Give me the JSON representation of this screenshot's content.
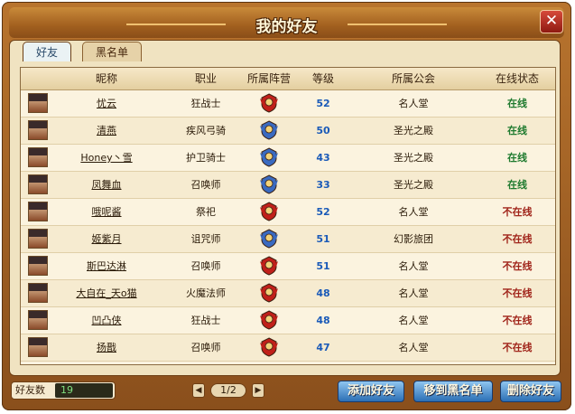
{
  "window": {
    "title": "我的好友",
    "close_label": "✕"
  },
  "tabs": [
    {
      "label": "好友"
    },
    {
      "label": "黑名单"
    }
  ],
  "table": {
    "headers": [
      "昵称",
      "职业",
      "所属阵营",
      "等级",
      "所属公会",
      "在线状态"
    ],
    "rows": [
      {
        "name": "忧云",
        "job": "狂战士",
        "faction": "red",
        "level": "52",
        "guild": "名人堂",
        "status": "在线"
      },
      {
        "name": "清燕",
        "job": "疾风弓骑",
        "faction": "blue",
        "level": "50",
        "guild": "圣光之殿",
        "status": "在线"
      },
      {
        "name": "Honey丶雪",
        "job": "护卫骑士",
        "faction": "blue",
        "level": "43",
        "guild": "圣光之殿",
        "status": "在线"
      },
      {
        "name": "凤舞血",
        "job": "召唤师",
        "faction": "blue",
        "level": "33",
        "guild": "圣光之殿",
        "status": "在线"
      },
      {
        "name": "哦呢酱",
        "job": "祭祀",
        "faction": "red",
        "level": "52",
        "guild": "名人堂",
        "status": "不在线"
      },
      {
        "name": "姬紫月",
        "job": "诅咒师",
        "faction": "blue",
        "level": "51",
        "guild": "幻影旅团",
        "status": "不在线"
      },
      {
        "name": "斯巴达淋",
        "job": "召唤师",
        "faction": "red",
        "level": "51",
        "guild": "名人堂",
        "status": "不在线"
      },
      {
        "name": "大自在_天o猫",
        "job": "火魔法师",
        "faction": "red",
        "level": "48",
        "guild": "名人堂",
        "status": "不在线"
      },
      {
        "name": "凹凸侠",
        "job": "狂战士",
        "faction": "red",
        "level": "48",
        "guild": "名人堂",
        "status": "不在线"
      },
      {
        "name": "扬戬",
        "job": "召唤师",
        "faction": "red",
        "level": "47",
        "guild": "名人堂",
        "status": "不在线"
      }
    ]
  },
  "footer": {
    "friend_count_label": "好友数",
    "friend_count": "19",
    "page": "1/2",
    "prev_icon": "◀",
    "next_icon": "▶",
    "buttons": {
      "add": "添加好友",
      "blacklist": "移到黑名单",
      "delete": "删除好友"
    }
  },
  "colors": {
    "online": "#1e7a2e",
    "offline": "#a0241a",
    "level": "#1a5ab8",
    "faction_red": "#c0201a",
    "faction_blue": "#3a6ac0"
  }
}
